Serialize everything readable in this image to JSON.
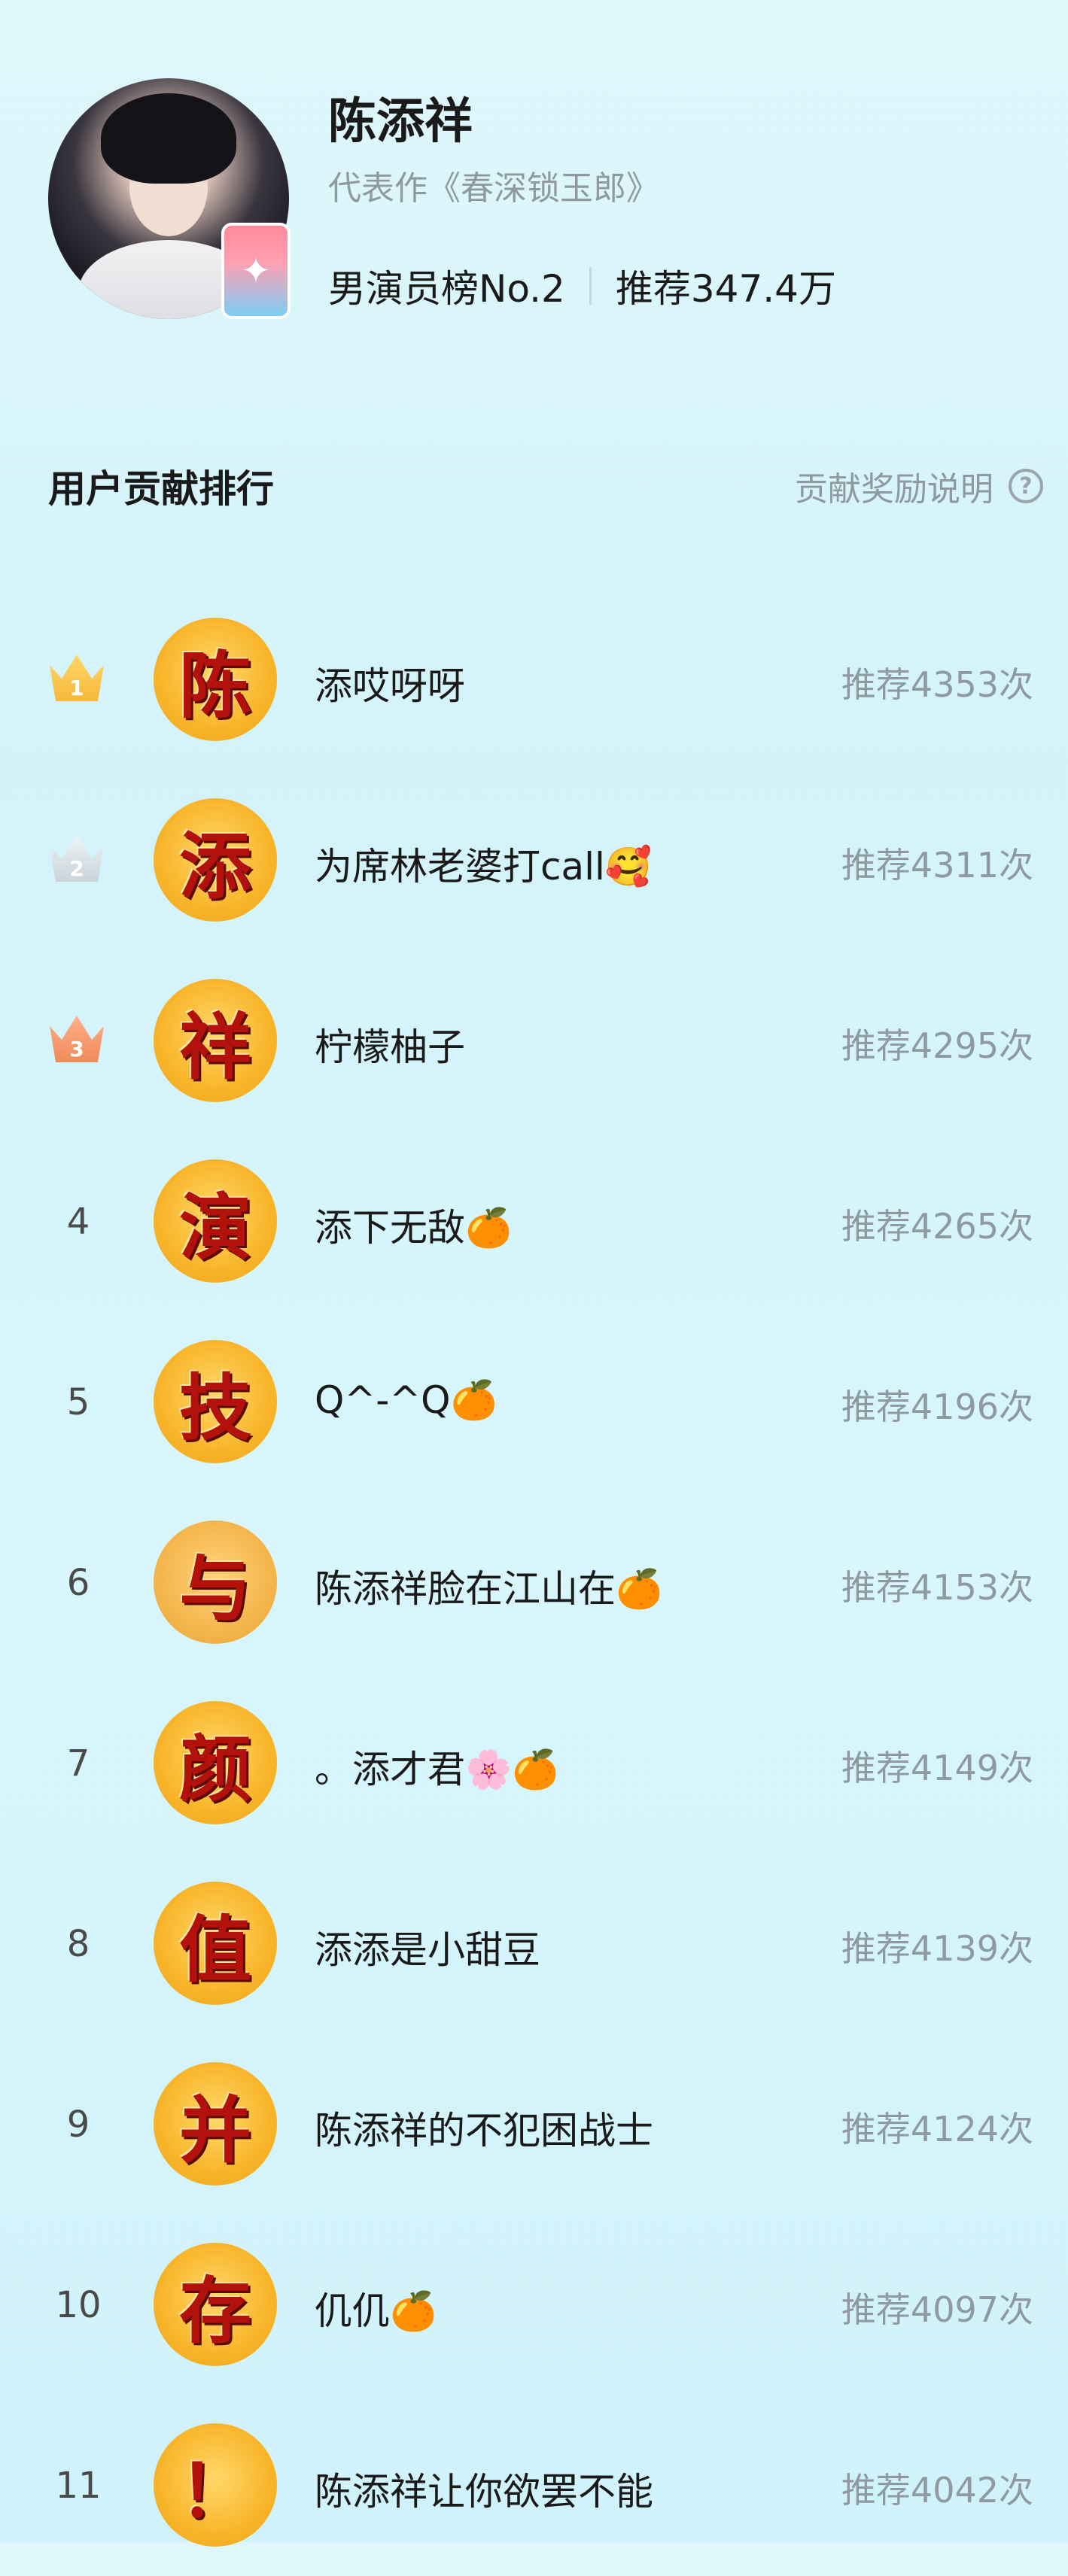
{
  "profile": {
    "name": "陈添祥",
    "works": "代表作《春深锁玉郎》",
    "rank_label": "男演员榜No.2",
    "recommend_total": "推荐347.4万",
    "badge_icon": "sparkle-icon"
  },
  "section": {
    "title": "用户贡献排行",
    "link_label": "贡献奖励说明",
    "help_icon": "?"
  },
  "colors": {
    "gold": "#f8b52a",
    "crown_gold": "#f7b73b",
    "crown_silver": "#c9d4da",
    "crown_bronze": "#f08a5a",
    "glyph_red": "#b3120c",
    "muted": "#8e9aa0"
  },
  "ranking": [
    {
      "rank": "1",
      "glyph": "陈",
      "name": "添哎呀呀",
      "count": "推荐4353次"
    },
    {
      "rank": "2",
      "glyph": "添",
      "name": "为席林老婆打call🥰",
      "count": "推荐4311次"
    },
    {
      "rank": "3",
      "glyph": "祥",
      "name": "柠檬柚子",
      "count": "推荐4295次"
    },
    {
      "rank": "4",
      "glyph": "演",
      "name": "添下无敌🍊",
      "count": "推荐4265次"
    },
    {
      "rank": "5",
      "glyph": "技",
      "name": "Q^-^Q🍊",
      "count": "推荐4196次"
    },
    {
      "rank": "6",
      "glyph": "与",
      "name": "陈添祥脸在江山在🍊",
      "count": "推荐4153次"
    },
    {
      "rank": "7",
      "glyph": "颜",
      "name": "。添才君🌸🍊",
      "count": "推荐4149次"
    },
    {
      "rank": "8",
      "glyph": "值",
      "name": "添添是小甜豆",
      "count": "推荐4139次"
    },
    {
      "rank": "9",
      "glyph": "并",
      "name": "陈添祥的不犯困战士",
      "count": "推荐4124次"
    },
    {
      "rank": "10",
      "glyph": "存",
      "name": "仉仉🍊",
      "count": "推荐4097次"
    },
    {
      "rank": "11",
      "glyph": "！",
      "name": "陈添祥让你欲罢不能",
      "count": "推荐4042次"
    }
  ]
}
